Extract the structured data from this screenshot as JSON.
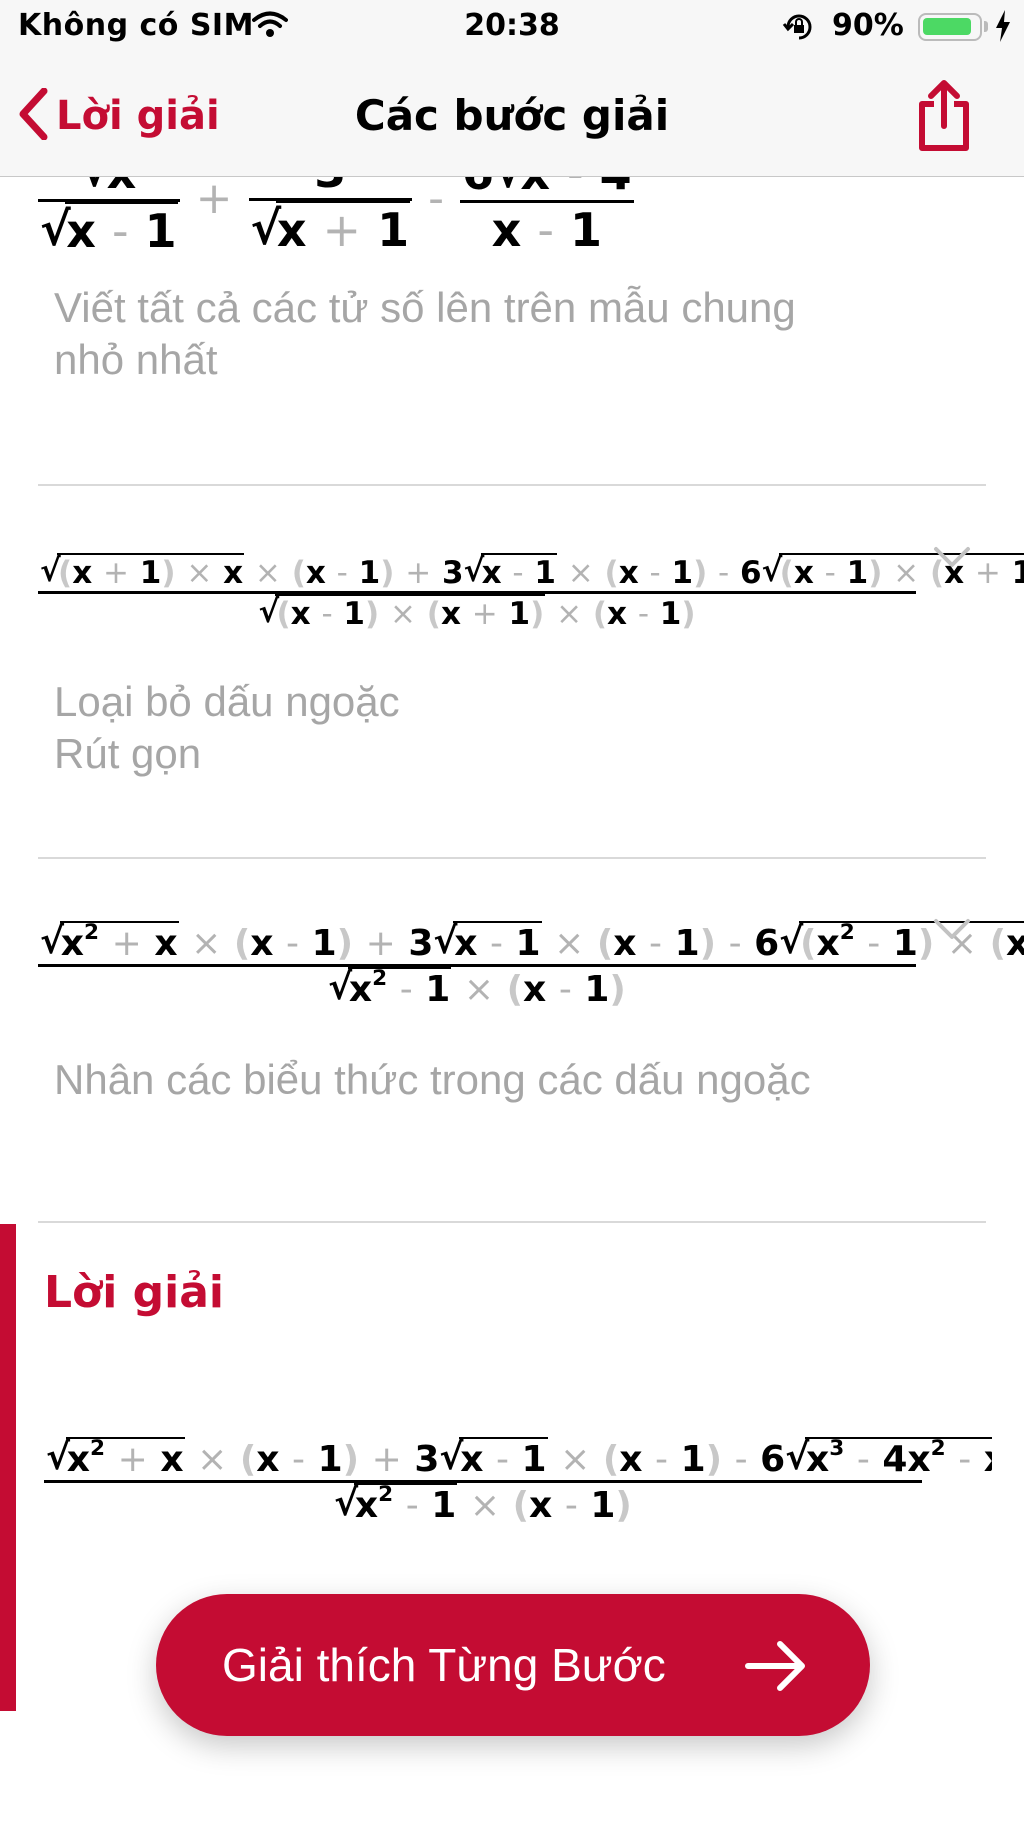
{
  "status_bar": {
    "carrier": "Không có SIM",
    "time": "20:38",
    "battery": "90%",
    "battery_level": 0.9
  },
  "nav": {
    "back_label": "Lời giải",
    "title": "Các bước giải"
  },
  "steps": [
    {
      "description_lines": [
        "Viết tất cả các tử số lên trên mẫu chung",
        "nhỏ nhất"
      ]
    },
    {
      "description_lines": [
        "Loại bỏ dấu ngoặc",
        "Rút gọn"
      ]
    },
    {
      "description_lines": [
        "Nhân các biểu thức trong các dấu ngoặc"
      ]
    }
  ],
  "solution": {
    "title": "Lời giải"
  },
  "cta": {
    "label": "Giải thích Từng Bước"
  },
  "colors": {
    "accent": "#c40c33",
    "battery": "#4cd964",
    "muted_text": "#a6a6a6"
  },
  "icons": [
    "wifi-icon",
    "orientation-lock-icon",
    "battery-icon",
    "charging-icon",
    "chevron-left-icon",
    "share-icon",
    "chevron-down-icon",
    "arrow-right-icon"
  ]
}
